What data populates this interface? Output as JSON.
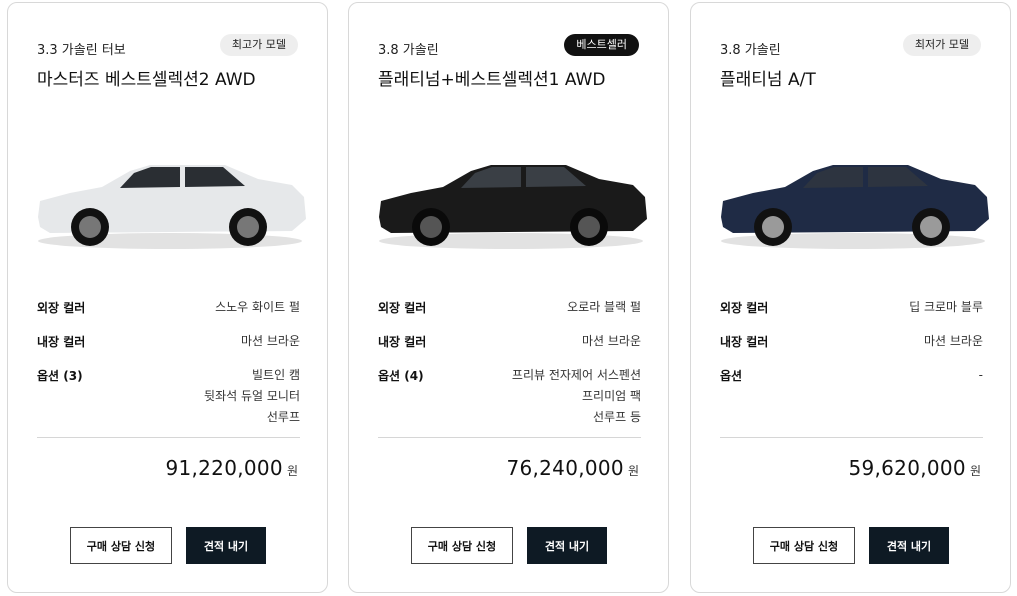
{
  "cards": [
    {
      "engine": "3.3 가솔린 터보",
      "badge": "최고가 모델",
      "badge_style": "light",
      "model": "마스터즈 베스트셀렉션2 AWD",
      "car_color": "#e6e8ea",
      "specs": [
        {
          "label": "외장 컬러",
          "values": [
            "스노우 화이트 펄"
          ]
        },
        {
          "label": "내장 컬러",
          "values": [
            "마션 브라운"
          ]
        },
        {
          "label": "옵션 (3)",
          "values": [
            "빌트인 캠",
            "뒷좌석 듀얼 모니터",
            "선루프"
          ]
        }
      ],
      "price": "91,220,000",
      "price_unit": "원",
      "consult_label": "구매 상담 신청",
      "quote_label": "견적 내기"
    },
    {
      "engine": "3.8 가솔린",
      "badge": "베스트셀러",
      "badge_style": "dark",
      "model": "플래티넘+베스트셀렉션1 AWD",
      "car_color": "#1a1a1a",
      "specs": [
        {
          "label": "외장 컬러",
          "values": [
            "오로라 블랙 펄"
          ]
        },
        {
          "label": "내장 컬러",
          "values": [
            "마션 브라운"
          ]
        },
        {
          "label": "옵션 (4)",
          "values": [
            "프리뷰 전자제어 서스펜션",
            "프리미엄 팩",
            "선루프 등"
          ]
        }
      ],
      "price": "76,240,000",
      "price_unit": "원",
      "consult_label": "구매 상담 신청",
      "quote_label": "견적 내기"
    },
    {
      "engine": "3.8 가솔린",
      "badge": "최저가 모델",
      "badge_style": "light",
      "model": "플래티넘 A/T",
      "car_color": "#1f2b45",
      "specs": [
        {
          "label": "외장 컬러",
          "values": [
            "딥 크로마 블루"
          ]
        },
        {
          "label": "내장 컬러",
          "values": [
            "마션 브라운"
          ]
        },
        {
          "label": "옵션",
          "values": [
            "-"
          ]
        }
      ],
      "price": "59,620,000",
      "price_unit": "원",
      "consult_label": "구매 상담 신청",
      "quote_label": "견적 내기"
    }
  ]
}
